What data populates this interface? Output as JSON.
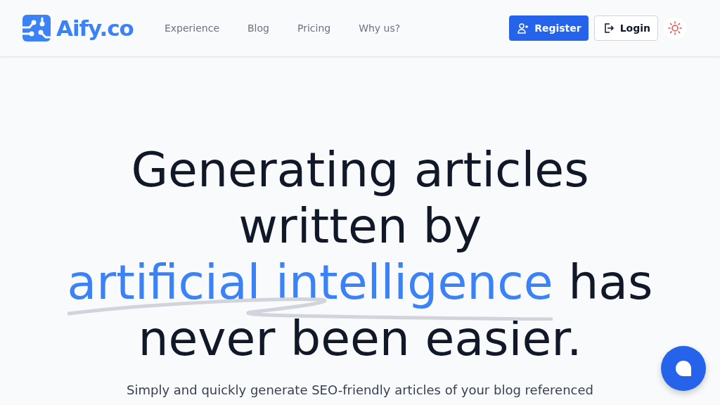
{
  "header": {
    "logo": "Aify.co",
    "nav": [
      {
        "label": "Experience"
      },
      {
        "label": "Blog"
      },
      {
        "label": "Pricing"
      },
      {
        "label": "Why us?"
      }
    ],
    "register": "Register",
    "login": "Login"
  },
  "hero": {
    "heading": [
      {
        "text": "Generating articles written by",
        "highlight": false
      },
      {
        "text": "artificial intelligence",
        "highlight": true
      },
      {
        "text": "has never been easier.",
        "highlight": false
      }
    ],
    "subtitle": "Simply and quickly generate SEO-friendly articles of your blog referenced"
  }
}
